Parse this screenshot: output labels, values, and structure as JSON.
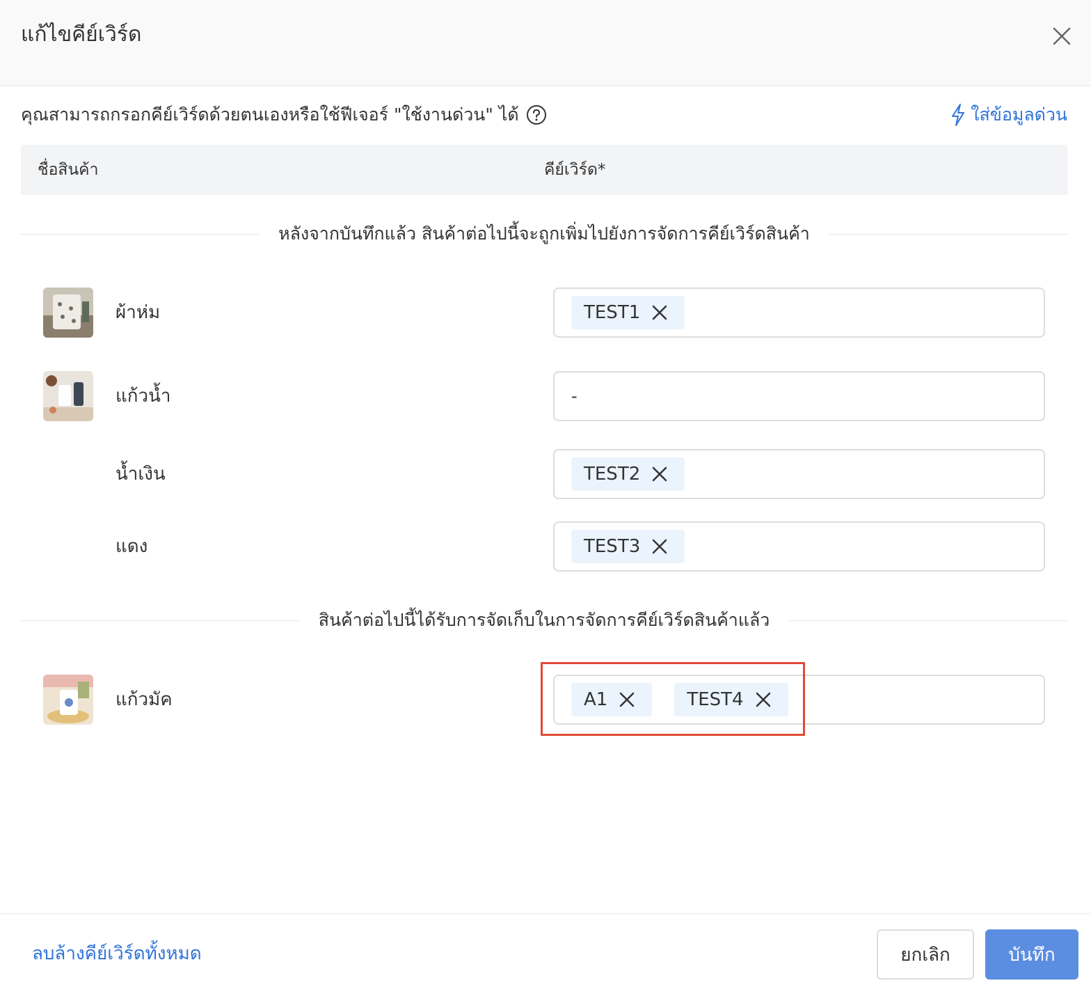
{
  "dialog": {
    "title": "แก้ไขคีย์เวิร์ด",
    "helper_text": "คุณสามารถกรอกคีย์เวิร์ดด้วยตนเองหรือใช้ฟีเจอร์ \"ใช้งานด่วน\" ได้",
    "quick_fill_label": "ใส่ข้อมูลด่วน"
  },
  "table": {
    "col_name": "ชื่อสินค้า",
    "col_keyword": "คีย์เวิร์ด*"
  },
  "sections": [
    {
      "label": "หลังจากบันทึกแล้ว สินค้าต่อไปนี้จะถูกเพิ่มไปยังการจัดการคีย์เวิร์ดสินค้า",
      "rows": [
        {
          "name": "ผ้าห่ม",
          "keywords": [
            "TEST1"
          ]
        },
        {
          "name": "แก้วน้ำ",
          "empty_value": "-"
        },
        {
          "name": "น้ำเงิน",
          "keywords": [
            "TEST2"
          ]
        },
        {
          "name": "แดง",
          "keywords": [
            "TEST3"
          ]
        }
      ]
    },
    {
      "label": "สินค้าต่อไปนี้ได้รับการจัดเก็บในการจัดการคีย์เวิร์ดสินค้าแล้ว",
      "rows": [
        {
          "name": "แก้วมัค",
          "keywords": [
            "A1",
            "TEST4"
          ]
        }
      ]
    }
  ],
  "footer": {
    "clear_all_label": "ลบล้างคีย์เวิร์ดทั้งหมด",
    "cancel_label": "ยกเลิก",
    "save_label": "บันทึก"
  },
  "colors": {
    "accent": "#2f73d9",
    "primary_button": "#5b8de0",
    "tag_background": "#ebf4fd",
    "highlight": "#e04a35"
  },
  "icons": [
    "close-icon",
    "help-circle-icon",
    "lightning-icon",
    "tag-remove-icon"
  ]
}
